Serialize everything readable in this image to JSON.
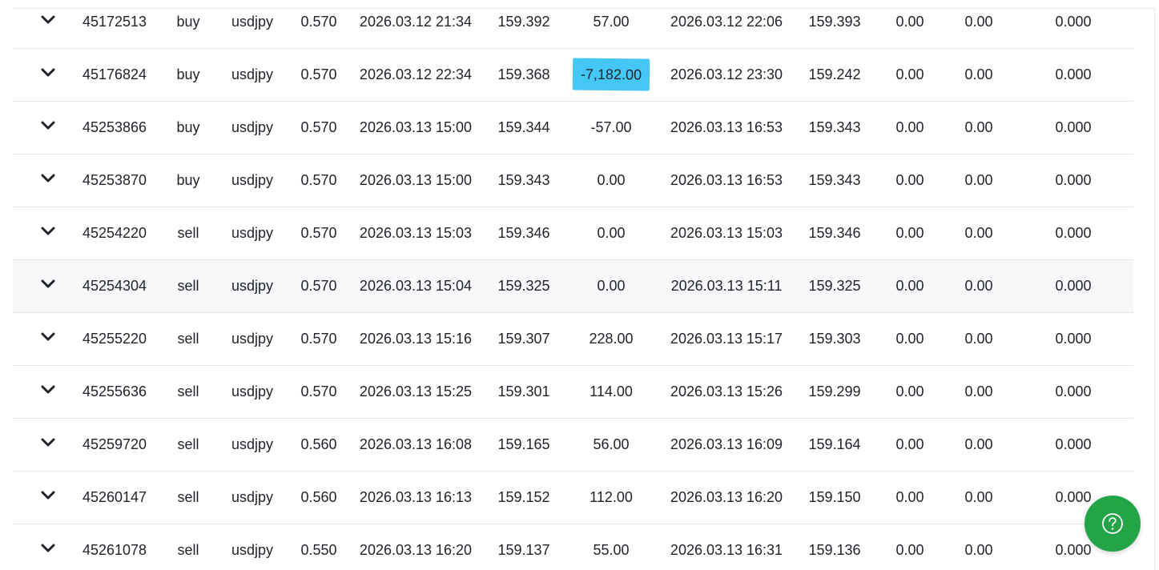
{
  "trades": [
    {
      "ticket": "45172513",
      "type": "buy",
      "symbol": "usdjpy",
      "volume": "0.570",
      "open_time": "2026.03.12 21:34",
      "open_price": "159.392",
      "profit": "57.00",
      "close_time": "2026.03.12 22:06",
      "close_price": "159.393",
      "commission": "0.00",
      "swap": "0.00",
      "extra": "0.000"
    },
    {
      "ticket": "45176824",
      "type": "buy",
      "symbol": "usdjpy",
      "volume": "0.570",
      "open_time": "2026.03.12 22:34",
      "open_price": "159.368",
      "profit": "-7,182.00",
      "close_time": "2026.03.12 23:30",
      "close_price": "159.242",
      "commission": "0.00",
      "swap": "0.00",
      "extra": "0.000",
      "highlighted": true
    },
    {
      "ticket": "45253866",
      "type": "buy",
      "symbol": "usdjpy",
      "volume": "0.570",
      "open_time": "2026.03.13 15:00",
      "open_price": "159.344",
      "profit": "-57.00",
      "close_time": "2026.03.13 16:53",
      "close_price": "159.343",
      "commission": "0.00",
      "swap": "0.00",
      "extra": "0.000"
    },
    {
      "ticket": "45253870",
      "type": "buy",
      "symbol": "usdjpy",
      "volume": "0.570",
      "open_time": "2026.03.13 15:00",
      "open_price": "159.343",
      "profit": "0.00",
      "close_time": "2026.03.13 16:53",
      "close_price": "159.343",
      "commission": "0.00",
      "swap": "0.00",
      "extra": "0.000"
    },
    {
      "ticket": "45254220",
      "type": "sell",
      "symbol": "usdjpy",
      "volume": "0.570",
      "open_time": "2026.03.13 15:03",
      "open_price": "159.346",
      "profit": "0.00",
      "close_time": "2026.03.13 15:03",
      "close_price": "159.346",
      "commission": "0.00",
      "swap": "0.00",
      "extra": "0.000"
    },
    {
      "ticket": "45254304",
      "type": "sell",
      "symbol": "usdjpy",
      "volume": "0.570",
      "open_time": "2026.03.13 15:04",
      "open_price": "159.325",
      "profit": "0.00",
      "close_time": "2026.03.13 15:11",
      "close_price": "159.325",
      "commission": "0.00",
      "swap": "0.00",
      "extra": "0.000",
      "hovered": true
    },
    {
      "ticket": "45255220",
      "type": "sell",
      "symbol": "usdjpy",
      "volume": "0.570",
      "open_time": "2026.03.13 15:16",
      "open_price": "159.307",
      "profit": "228.00",
      "close_time": "2026.03.13 15:17",
      "close_price": "159.303",
      "commission": "0.00",
      "swap": "0.00",
      "extra": "0.000"
    },
    {
      "ticket": "45255636",
      "type": "sell",
      "symbol": "usdjpy",
      "volume": "0.570",
      "open_time": "2026.03.13 15:25",
      "open_price": "159.301",
      "profit": "114.00",
      "close_time": "2026.03.13 15:26",
      "close_price": "159.299",
      "commission": "0.00",
      "swap": "0.00",
      "extra": "0.000"
    },
    {
      "ticket": "45259720",
      "type": "sell",
      "symbol": "usdjpy",
      "volume": "0.560",
      "open_time": "2026.03.13 16:08",
      "open_price": "159.165",
      "profit": "56.00",
      "close_time": "2026.03.13 16:09",
      "close_price": "159.164",
      "commission": "0.00",
      "swap": "0.00",
      "extra": "0.000"
    },
    {
      "ticket": "45260147",
      "type": "sell",
      "symbol": "usdjpy",
      "volume": "0.560",
      "open_time": "2026.03.13 16:13",
      "open_price": "159.152",
      "profit": "112.00",
      "close_time": "2026.03.13 16:20",
      "close_price": "159.150",
      "commission": "0.00",
      "swap": "0.00",
      "extra": "0.000"
    },
    {
      "ticket": "45261078",
      "type": "sell",
      "symbol": "usdjpy",
      "volume": "0.550",
      "open_time": "2026.03.13 16:20",
      "open_price": "159.137",
      "profit": "55.00",
      "close_time": "2026.03.13 16:31",
      "close_price": "159.136",
      "commission": "0.00",
      "swap": "0.00",
      "extra": "0.000"
    }
  ],
  "colors": {
    "highlight": "#45c7f5",
    "help_button": "#22a447",
    "hover_row": "#f7f8fa",
    "text": "#1f2329"
  },
  "icons": {
    "expand": "chevron-down-icon",
    "help": "question-circle-icon"
  }
}
